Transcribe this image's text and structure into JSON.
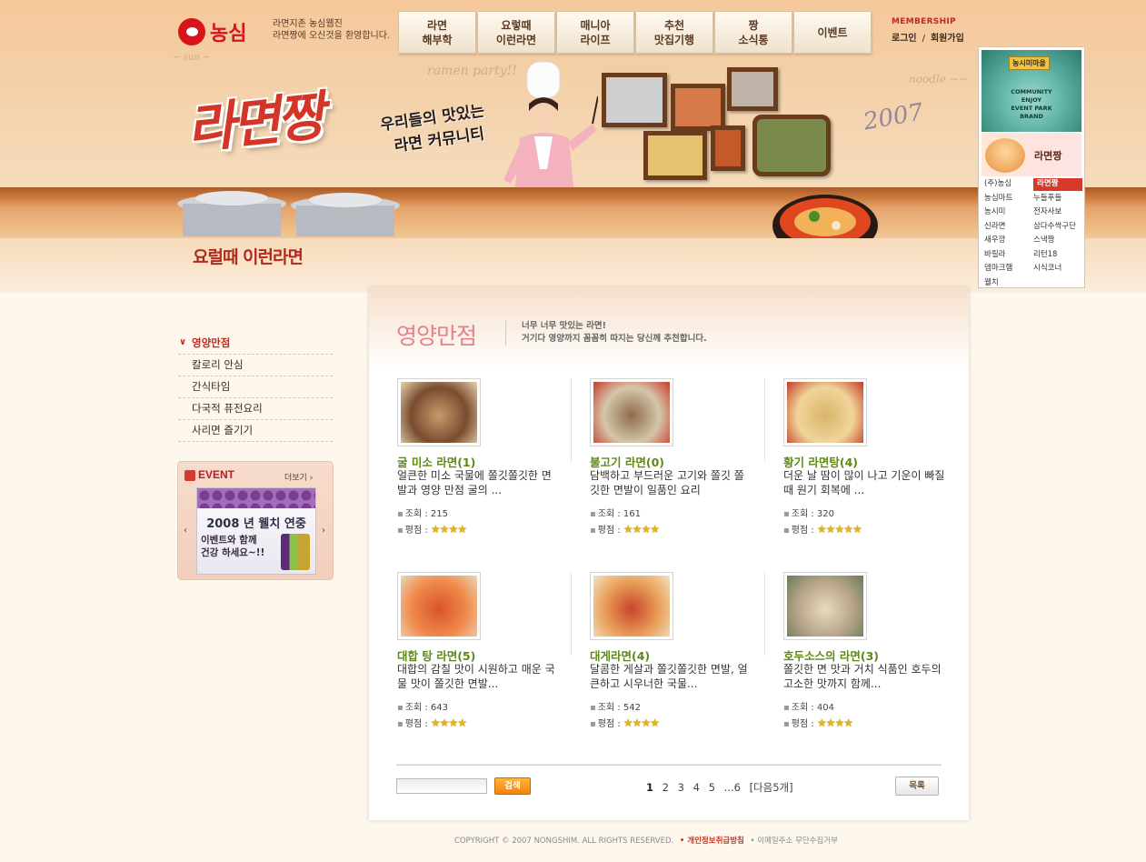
{
  "brand": {
    "logo_text": "농심",
    "tagline_line1": "라면지존 농심웹진",
    "tagline_line2": "라면짱에 오신것을 환영합니다.",
    "title": "라면짱",
    "subtitle_line1": "우리들의 맛있는",
    "subtitle_line2": "라면 커뮤니티",
    "year_doodle": "2007"
  },
  "nav": {
    "tabs": [
      {
        "label": "라면\n해부학"
      },
      {
        "label": "요렇때\n이런라면"
      },
      {
        "label": "매니아\n라이프"
      },
      {
        "label": "추천\n맛집기행"
      },
      {
        "label": "짱\n소식통"
      },
      {
        "label": "이벤트"
      }
    ]
  },
  "membership": {
    "title": "MEMBERSHIP",
    "login": "로그인",
    "separator": "/",
    "join": "회원가입"
  },
  "side_panel": {
    "community_badge": "농시미마을",
    "community_text": "COMMUNITY\nENJOY\nEVENT PARK\nBRAND",
    "ramen_label": "라면짱",
    "links": [
      "(주)농심",
      "라면짱",
      "농심마트",
      "누들푸들",
      "농시미",
      "전자사보",
      "신라면",
      "삼다수싹구단",
      "새우깡",
      "스낵짱",
      "바릴라",
      "리턴18",
      "뎀마크햄",
      "시식코너",
      "웰치"
    ],
    "active_link": "라면짱"
  },
  "section": {
    "title": "요럴때 이런라면"
  },
  "left_menu": {
    "items": [
      {
        "label": "영양만점",
        "active": true
      },
      {
        "label": "칼로리 안심",
        "active": false
      },
      {
        "label": "간식타임",
        "active": false
      },
      {
        "label": "다국적 퓨전요리",
        "active": false
      },
      {
        "label": "사리면 즐기기",
        "active": false
      }
    ]
  },
  "event": {
    "head": "EVENT",
    "more": "더보기 ›",
    "banner_line1": "2008 년 웰치 연중",
    "banner_line2": "이벤트와 함께\n건강 하세요~!!",
    "prev": "‹",
    "next": "›"
  },
  "content": {
    "title": "영양만점",
    "description": "너무 너무 맛있는 라면!\n거기다 영양까지 꼼꼼히 따지는 당신께 추천합니다.",
    "views_label": "조회 : ",
    "rating_label": "평점 : ",
    "cards": [
      {
        "title": "굴 미소 라면(1)",
        "desc": "얼큰한 미소 국물에 쫄깃쫄깃한 면발과 영양 만점 굴의 ...",
        "views": "215",
        "rating": 4,
        "colors": [
          "#c89a6a",
          "#7a4c30",
          "#e7d5b0"
        ]
      },
      {
        "title": "불고기 라면(0)",
        "desc": "담백하고 부드러운 고기와 쫄깃 쫄깃한 면발이 일품인 요리",
        "views": "161",
        "rating": 4,
        "colors": [
          "#8f6b4b",
          "#d4c6aa",
          "#c83a2a"
        ]
      },
      {
        "title": "황기 라면탕(4)",
        "desc": "더운 날 땀이 많이 나고 기운이 빠질 때 원기 회복에 ...",
        "views": "320",
        "rating": 5,
        "colors": [
          "#d9b46a",
          "#f0d59a",
          "#c33b25"
        ]
      },
      {
        "title": "대합 탕 라면(5)",
        "desc": "대합의 감칠 맛이 시원하고 매운 국물 맛이 쫄깃한 면발...",
        "views": "643",
        "rating": 4,
        "colors": [
          "#d8542c",
          "#f08a4a",
          "#e9d6b8"
        ]
      },
      {
        "title": "대게라면(4)",
        "desc": "달콤한 게살과 쫄깃쫄깃한 면발, 얼큰하고 시우너한 국물...",
        "views": "542",
        "rating": 4,
        "colors": [
          "#c9442a",
          "#e9a15a",
          "#f3e2c4"
        ]
      },
      {
        "title": "호두소스의 라면(3)",
        "desc": "쫄깃한 면 맛과 거치 식품인 호두의 고소한 맛까지 함께...",
        "views": "404",
        "rating": 4,
        "colors": [
          "#e8dcc0",
          "#b7a489",
          "#6b7a5a"
        ]
      }
    ],
    "search_button": "검색",
    "search_value": "",
    "pager": {
      "pages": [
        "1",
        "2",
        "3",
        "4",
        "5",
        "...6"
      ],
      "current": "1",
      "next": "[다음5개]"
    },
    "list_button": "목록"
  },
  "footer": {
    "copyright": "COPYRIGHT © 2007 NONGSHIM. ALL RIGHTS RESERVED.",
    "privacy": "• 개인정보취급방침",
    "no_email": "• 이메일주소 무단수집거부"
  },
  "colors": {
    "accent_red": "#c22b1e",
    "title_green": "#5c8a14",
    "content_title_pink": "#e6818a",
    "star_gold": "#e2b611"
  }
}
